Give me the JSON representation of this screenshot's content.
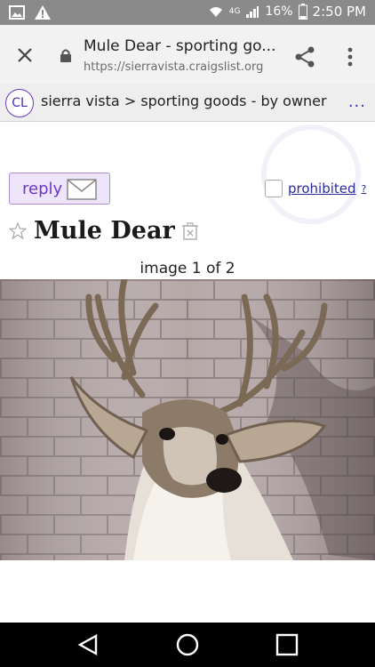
{
  "status": {
    "battery_pct": "16%",
    "time": "2:50 PM",
    "network": "4G"
  },
  "browser": {
    "page_title": "Mule Dear - sporting go...",
    "url": "https://sierravista.craigslist.org"
  },
  "cl": {
    "logo": "CL",
    "breadcrumb": [
      "sierra vista",
      ">",
      "sporting goods - by owner"
    ],
    "more": "..."
  },
  "post": {
    "reply_label": "reply",
    "prohibited_label": "prohibited",
    "prohibited_help": "?",
    "title": "Mule Dear",
    "image_counter": "image 1 of 2"
  },
  "colors": {
    "accent": "#6b37c8",
    "link": "#2a2aa3"
  }
}
